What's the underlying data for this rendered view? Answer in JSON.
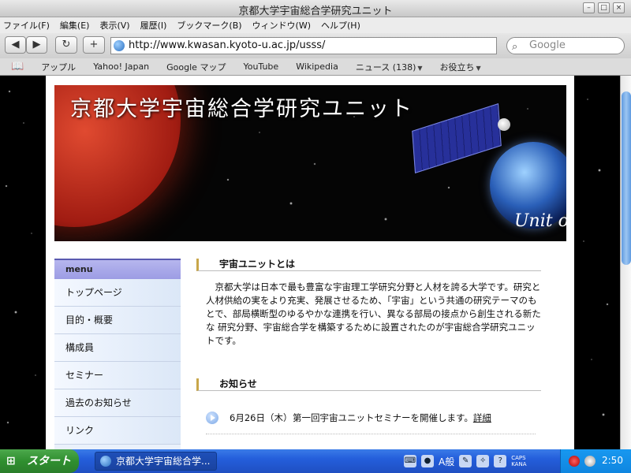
{
  "window": {
    "title": "京都大学宇宙総合学研究ユニット"
  },
  "menubar": [
    "ファイル(F)",
    "編集(E)",
    "表示(V)",
    "履歴(I)",
    "ブックマーク(B)",
    "ウィンドウ(W)",
    "ヘルプ(H)"
  ],
  "toolbar": {
    "back": "◀",
    "forward": "▶",
    "reload": "↻",
    "add": "+",
    "url": "http://www.kwasan.kyoto-u.ac.jp/usss/",
    "search_placeholder": "Google"
  },
  "bookmarks": {
    "icon": "📖",
    "items": [
      "アップル",
      "Yahoo! Japan",
      "Google マップ",
      "YouTube",
      "Wikipedia",
      "ニュース (138)",
      "お役立ち"
    ]
  },
  "banner": {
    "title": "京都大学宇宙総合学研究ユニット",
    "subtitle": "Unit of"
  },
  "sidebar": {
    "header": "menu",
    "items": [
      "トップページ",
      "目的・概要",
      "構成員",
      "セミナー",
      "過去のお知らせ",
      "リンク"
    ]
  },
  "about": {
    "heading": "宇宙ユニットとは",
    "text": "　京都大学は日本で最も豊富な宇宙理工学研究分野と人材を誇る大学です。研究と人材供給の実をより充実、発展させるため、「宇宙」という共通の研究テーマのもとで、部局横断型のゆるやかな連携を行い、異なる部局の接点から創生される新たな 研究分野、宇宙総合学を構築するために設置されたのが宇宙総合学研究ユニットです。"
  },
  "news": {
    "heading": "お知らせ",
    "items": [
      {
        "date": "6月26日（木）",
        "text": "第一回宇宙ユニットセミナーを開催します。",
        "more": "詳細"
      }
    ]
  },
  "taskbar": {
    "start": "スタート",
    "window": "京都大学宇宙総合学...",
    "ime_mode": "A般",
    "caps": "CAPS",
    "kana": "KANA",
    "clock": "2:50"
  }
}
